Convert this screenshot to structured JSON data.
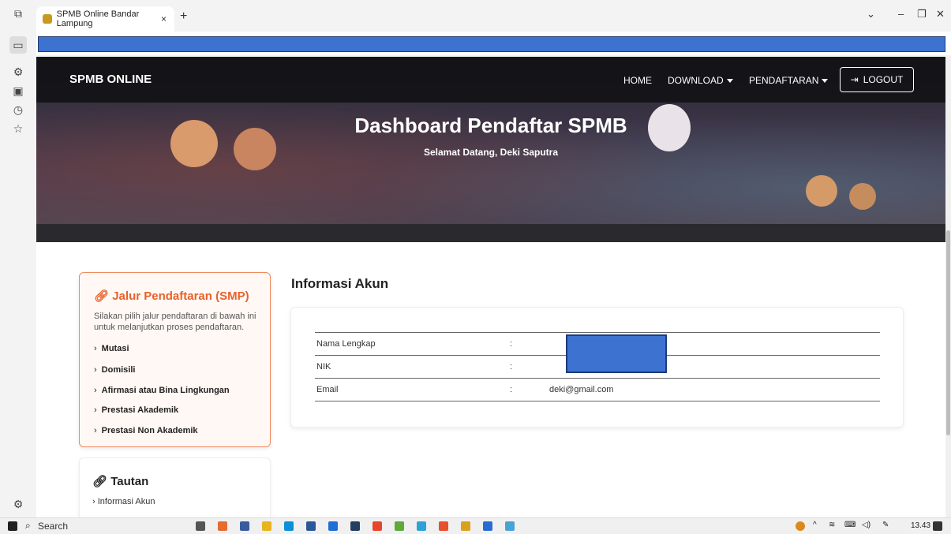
{
  "browser": {
    "tab_title": "SPMB Online Bandar Lampung",
    "tab_close": "×",
    "new_tab": "+"
  },
  "navbar": {
    "brand": "SPMB ONLINE",
    "home": "HOME",
    "download": "DOWNLOAD",
    "pendaftaran": "PENDAFTARAN",
    "logout": "LOGOUT"
  },
  "hero": {
    "title": "Dashboard Pendaftar SPMB",
    "subtitle": "Selamat Datang, Deki Saputra"
  },
  "jalur": {
    "title": "Jalur Pendaftaran (SMP)",
    "description": "Silakan pilih jalur pendaftaran di bawah ini untuk melanjutkan proses pendaftaran.",
    "items": [
      "Mutasi",
      "Domisili",
      "Afirmasi atau Bina Lingkungan",
      "Prestasi Akademik",
      "Prestasi Non Akademik"
    ]
  },
  "tautan": {
    "title": "Tautan",
    "items": [
      "Informasi Akun"
    ]
  },
  "info": {
    "title": "Informasi Akun",
    "rows": [
      {
        "label": "Nama Lengkap",
        "sep": ":",
        "value": ""
      },
      {
        "label": "NIK",
        "sep": ":",
        "value": ""
      },
      {
        "label": "Email",
        "sep": ":",
        "value": "deki@gmail.com"
      }
    ]
  },
  "taskbar": {
    "search": "Search",
    "time": "13.43"
  },
  "colors": {
    "accent_orange": "#e8612c",
    "redaction_blue": "#3d72d1",
    "navbar_dark": "#121216"
  }
}
